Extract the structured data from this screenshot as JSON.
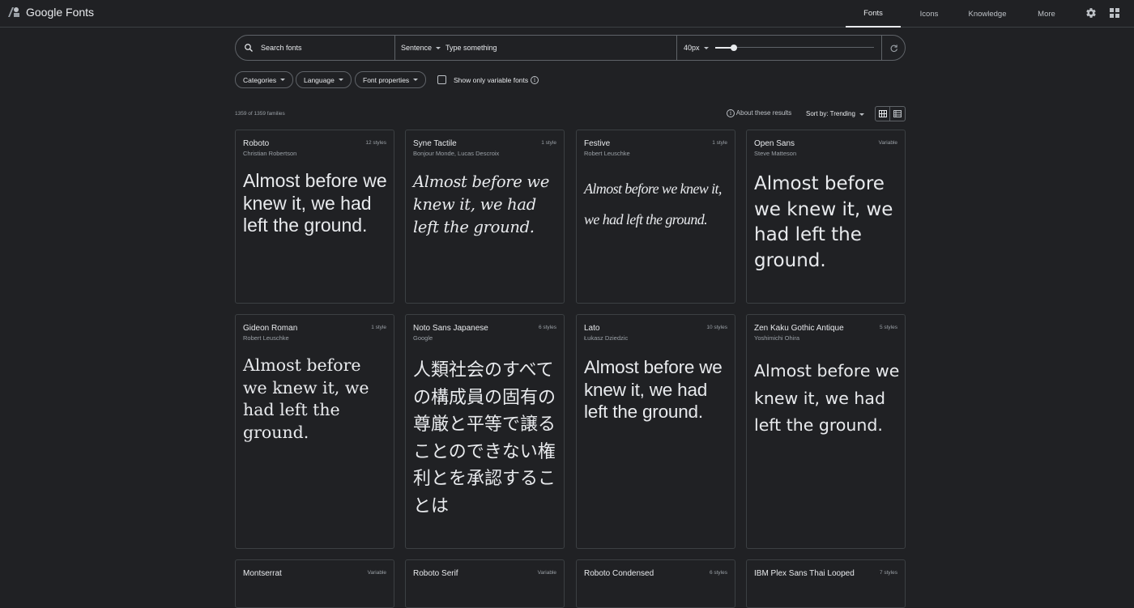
{
  "app": {
    "title": "Google Fonts"
  },
  "nav": {
    "fonts": "Fonts",
    "icons": "Icons",
    "knowledge": "Knowledge",
    "more": "More"
  },
  "search": {
    "placeholder": "Search fonts",
    "preview_mode": "Sentence",
    "preview_placeholder": "Type something",
    "size": "40px",
    "size_slider_fraction": 0.12
  },
  "filters": {
    "categories": "Categories",
    "language": "Language",
    "font_properties": "Font properties",
    "variable_only": "Show only variable fonts",
    "variable_only_checked": false
  },
  "results": {
    "count": "1359 of 1359 families",
    "about": "About these results",
    "sort": "Sort by: Trending"
  },
  "sample_text": "Almost before we knew it, we had left the ground.",
  "cards": [
    {
      "name": "Roboto",
      "author": "Christian Robertson",
      "styles": "12 styles",
      "sample": "Almost before we knew it, we had left the ground."
    },
    {
      "name": "Syne Tactile",
      "author": "Bonjour Monde, Lucas Descroix",
      "styles": "1 style",
      "sample": "Almost before we knew it, we had left the ground."
    },
    {
      "name": "Festive",
      "author": "Robert Leuschke",
      "styles": "1 style",
      "sample": "Almost before we knew it, we had left the ground."
    },
    {
      "name": "Open Sans",
      "author": "Steve Matteson",
      "styles": "Variable",
      "sample": "Almost before we knew it, we had left the ground."
    },
    {
      "name": "Gideon Roman",
      "author": "Robert Leuschke",
      "styles": "1 style",
      "sample": "Almost before we knew it, we had left the ground."
    },
    {
      "name": "Noto Sans Japanese",
      "author": "Google",
      "styles": "6 styles",
      "sample": "人類社会のすべての構成員の固有の尊厳と平等で譲ることのできない権利とを承認することは"
    },
    {
      "name": "Lato",
      "author": "Łukasz Dziedzic",
      "styles": "10 styles",
      "sample": "Almost before we knew it, we had left the ground."
    },
    {
      "name": "Zen Kaku Gothic Antique",
      "author": "Yoshimichi Ohira",
      "styles": "5 styles",
      "sample": "Almost before we knew it, we had left the ground."
    },
    {
      "name": "Montserrat",
      "author": "",
      "styles": "Variable",
      "sample": ""
    },
    {
      "name": "Roboto Serif",
      "author": "",
      "styles": "Variable",
      "sample": ""
    },
    {
      "name": "Roboto Condensed",
      "author": "",
      "styles": "6 styles",
      "sample": ""
    },
    {
      "name": "IBM Plex Sans Thai Looped",
      "author": "",
      "styles": "7 styles",
      "sample": ""
    }
  ]
}
